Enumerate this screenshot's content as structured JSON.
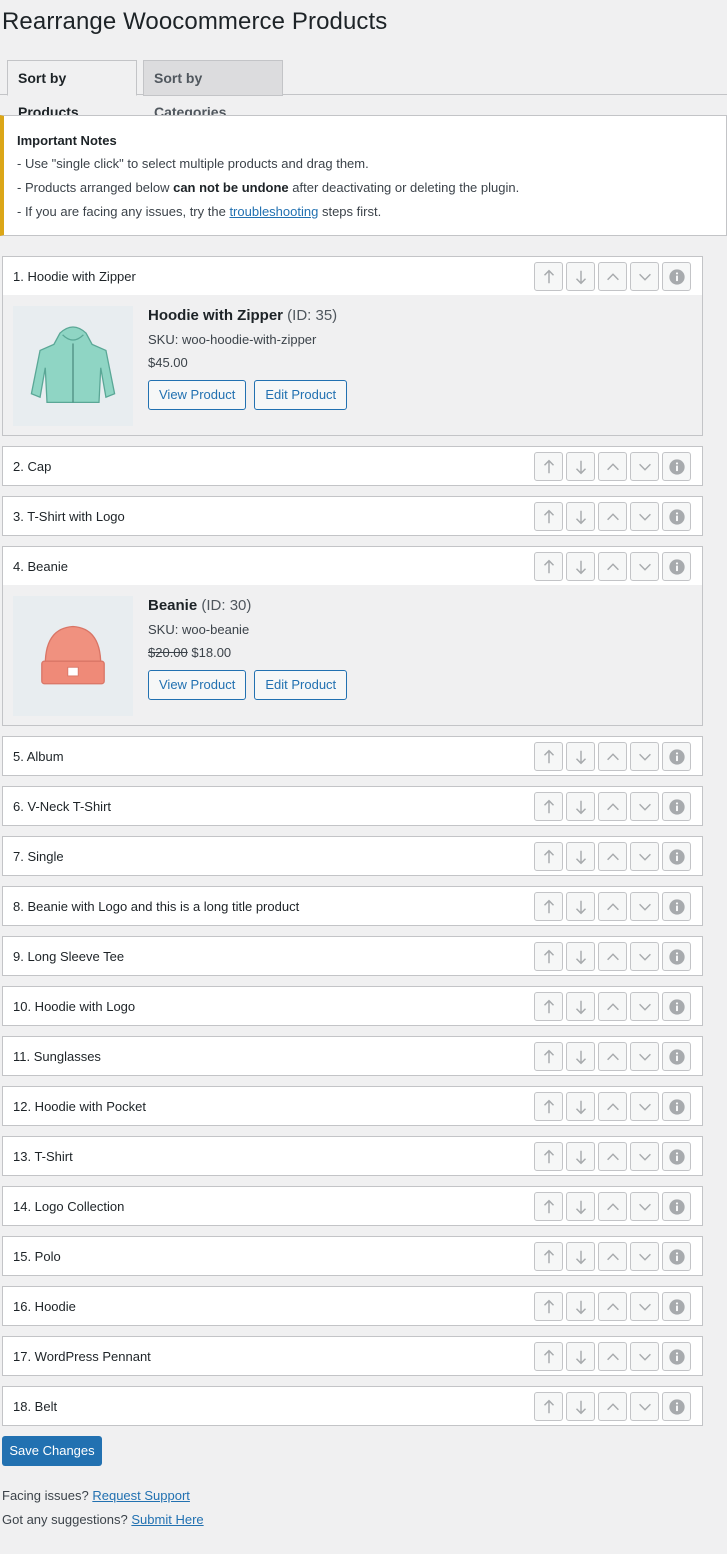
{
  "page": {
    "title": "Rearrange Woocommerce Products"
  },
  "tabs": [
    {
      "label": "Sort by Products",
      "active": true
    },
    {
      "label": "Sort by Categories",
      "active": false
    }
  ],
  "notice": {
    "title": "Important Notes",
    "line1": "- Use \"single click\" to select multiple products and drag them.",
    "line2_pre": "- Products arranged below ",
    "line2_bold": "can not be undone",
    "line2_post": " after deactivating or deleting the plugin.",
    "line3_pre": "- If you are facing any issues, try the ",
    "line3_link": "troubleshooting",
    "line3_post": " steps first."
  },
  "products": [
    {
      "title": "1. Hoodie with Zipper",
      "expanded": true,
      "name": "Hoodie with Zipper",
      "id_text": "(ID: 35)",
      "sku": "SKU: woo-hoodie-with-zipper",
      "price": "$45.00",
      "old_price": "",
      "image": "hoodie-icon"
    },
    {
      "title": "2. Cap"
    },
    {
      "title": "3. T-Shirt with Logo"
    },
    {
      "title": "4. Beanie",
      "expanded": true,
      "name": "Beanie",
      "id_text": "(ID: 30)",
      "sku": "SKU: woo-beanie",
      "price": "$18.00",
      "old_price": "$20.00",
      "image": "beanie-icon"
    },
    {
      "title": "5. Album"
    },
    {
      "title": "6. V-Neck T-Shirt"
    },
    {
      "title": "7. Single"
    },
    {
      "title": "8. Beanie with Logo and this is a long title product"
    },
    {
      "title": "9. Long Sleeve Tee"
    },
    {
      "title": "10. Hoodie with Logo"
    },
    {
      "title": "11. Sunglasses"
    },
    {
      "title": "12. Hoodie with Pocket"
    },
    {
      "title": "13. T-Shirt"
    },
    {
      "title": "14. Logo Collection"
    },
    {
      "title": "15. Polo"
    },
    {
      "title": "16. Hoodie"
    },
    {
      "title": "17. WordPress Pennant"
    },
    {
      "title": "18. Belt"
    }
  ],
  "buttons": {
    "view_product": "View Product",
    "edit_product": "Edit Product",
    "save_changes": "Save Changes"
  },
  "action_icons": [
    "arrow-up-icon",
    "arrow-down-icon",
    "chevron-up-icon",
    "chevron-down-icon",
    "info-icon"
  ],
  "footer": {
    "issues_text": "Facing issues?",
    "issues_link": "Request Support",
    "suggest_text": "Got any suggestions?",
    "suggest_link": "Submit Here"
  },
  "colors": {
    "accent": "#2271b1",
    "notice_border": "#dba617",
    "background": "#f0f0f1"
  }
}
